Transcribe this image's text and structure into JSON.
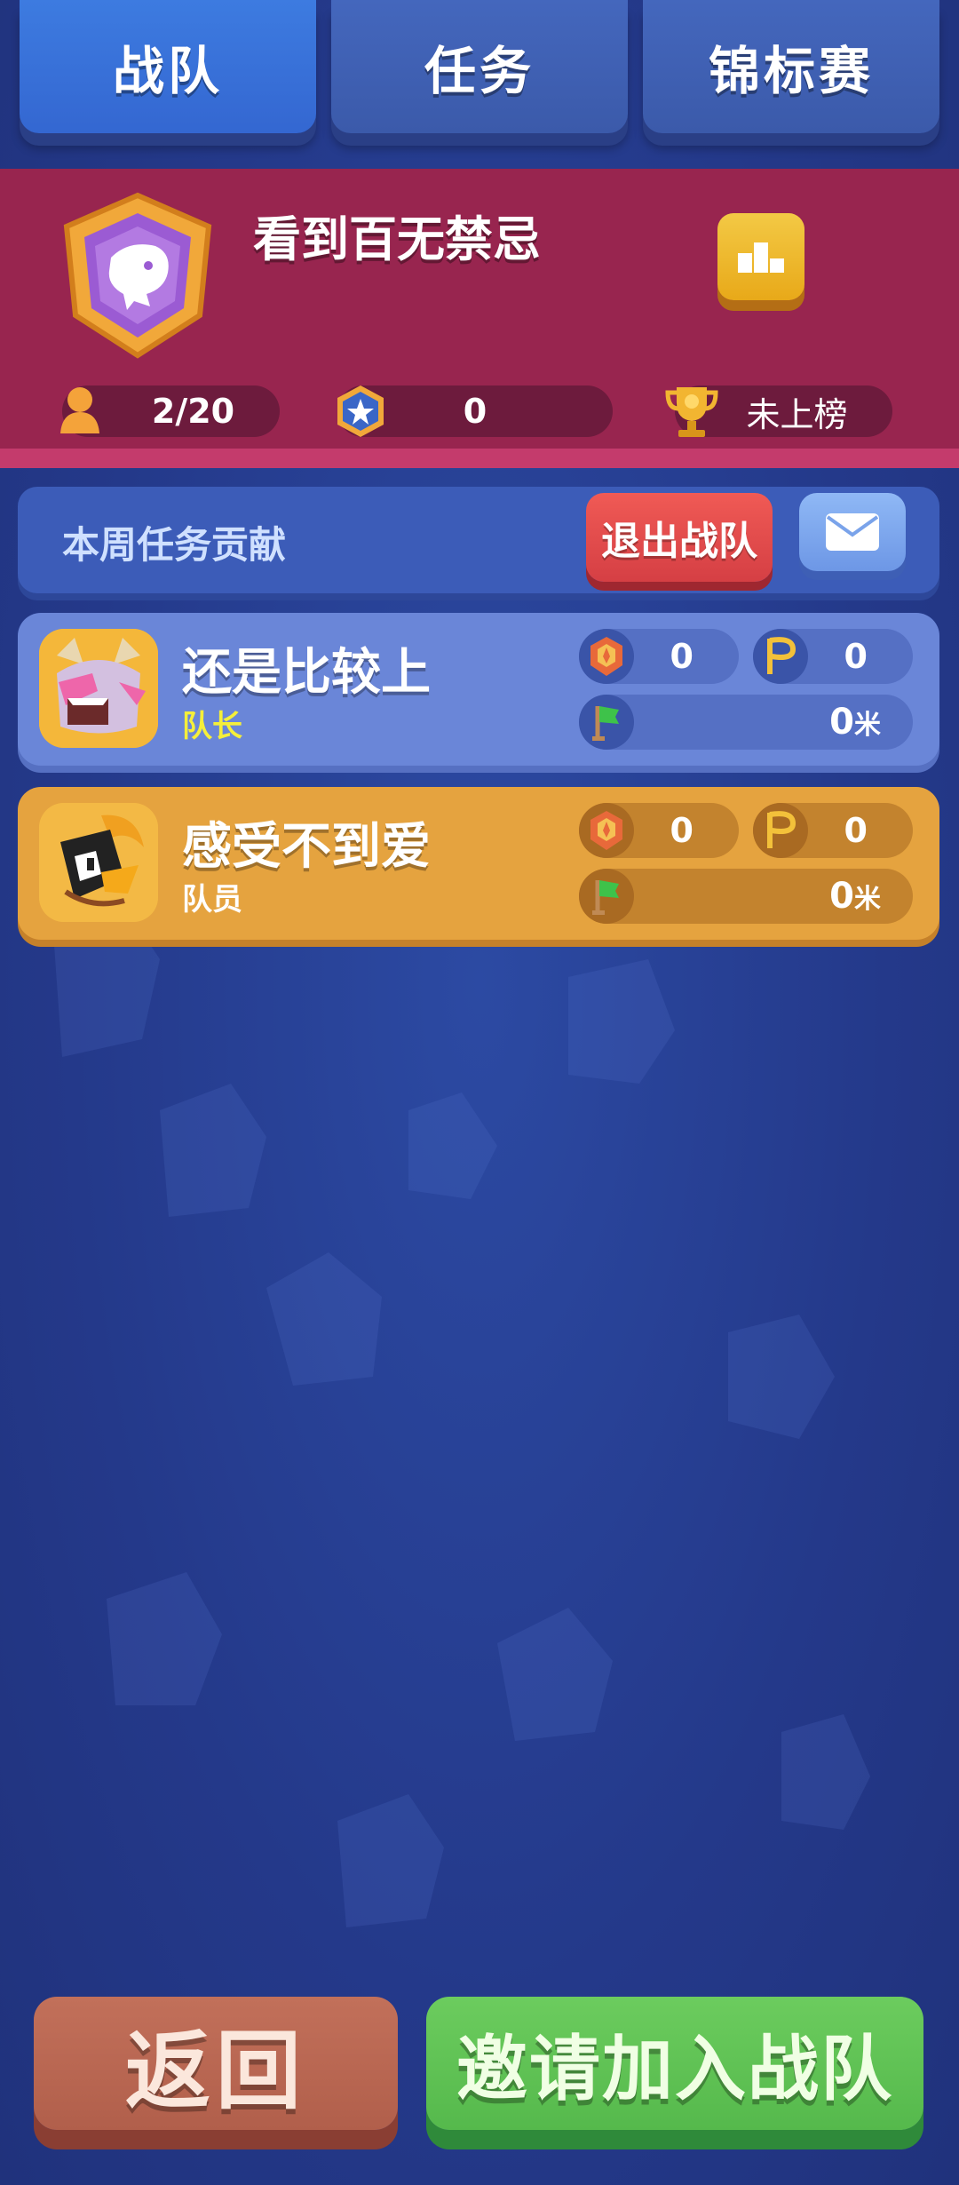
{
  "tabs": [
    {
      "label": "战队",
      "active": true
    },
    {
      "label": "任务",
      "active": false
    },
    {
      "label": "锦标赛",
      "active": false
    }
  ],
  "team": {
    "name": "看到百无禁忌",
    "members_count": "2/20",
    "star_score": "0",
    "rank_status": "未上榜"
  },
  "contribution": {
    "label": "本周任务贡献",
    "leave_label": "退出战队"
  },
  "members": [
    {
      "name": "还是比较上",
      "role": "队长",
      "medal_value": "0",
      "flag_value": "0",
      "distance": "0",
      "distance_unit": "米"
    },
    {
      "name": "感受不到爱",
      "role": "队员",
      "medal_value": "0",
      "flag_value": "0",
      "distance": "0",
      "distance_unit": "米"
    }
  ],
  "buttons": {
    "back": "返回",
    "invite": "邀请加入战队"
  },
  "colors": {
    "tab_active": "#3d7be0",
    "header": "#98254f",
    "captain_card": "#6a86d8",
    "member_card": "#e5a33f",
    "back_button": "#b8644d",
    "invite_button": "#5dc456"
  }
}
